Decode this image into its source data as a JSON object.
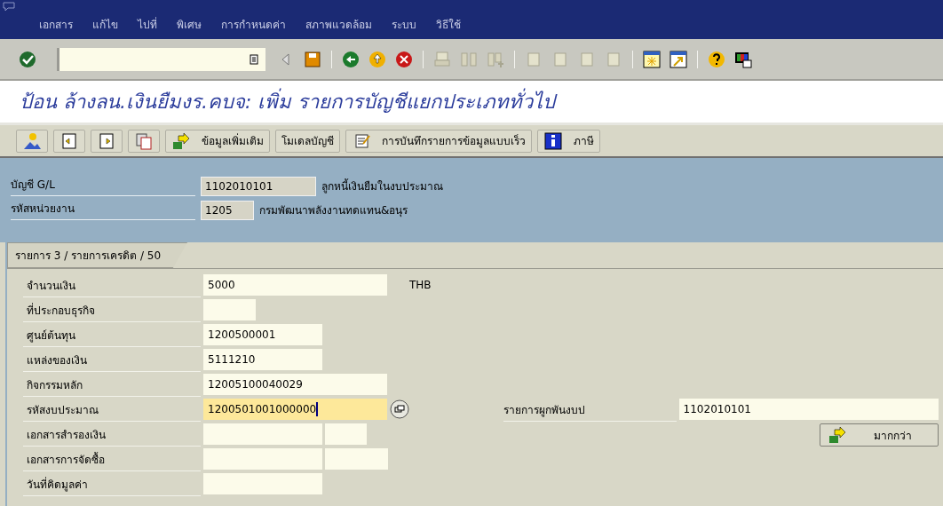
{
  "menu": [
    "เอกสาร",
    "แก้ไข",
    "ไปที่",
    "พิเศษ",
    "การกำหนดค่า",
    "สภาพแวดล้อม",
    "ระบบ",
    "วิธีใช้"
  ],
  "title": "ป้อน ล้างลน.เงินยืมงร.คบจ: เพิ่ม รายการบัญชีแยกประเภททั่วไป",
  "app_toolbar": [
    {
      "kind": "icon"
    },
    {
      "kind": "icon"
    },
    {
      "kind": "icon"
    },
    {
      "kind": "icon"
    },
    {
      "kind": "text",
      "label": "ข้อมูลเพิ่มเติม"
    },
    {
      "kind": "text",
      "label": "โมเดลบัญชี"
    },
    {
      "kind": "text",
      "label": "การบันทึกรายการข้อมูลแบบเร็ว"
    },
    {
      "kind": "text",
      "label": "ภาษี"
    }
  ],
  "header_fields": [
    {
      "label": "บัญชี G/L",
      "value": "1102010101",
      "description": "ลูกหนี้เงินยืมในงบประมาณ"
    },
    {
      "label": "รหัสหน่วยงาน",
      "value": "1205",
      "description": "กรมพัฒนาพลังงานทดแทน&อนุร"
    }
  ],
  "tab": "รายการ 3 / รายการเครดิต / 50",
  "fields": [
    {
      "label": "จำนวนเงิน",
      "value": "5000",
      "unit": "THB",
      "focused": false
    },
    {
      "label": "ที่ประกอบธุรกิจ",
      "focused": false
    },
    {
      "label": "ศูนย์ต้นทุน",
      "value": "1200500001",
      "focused": false
    },
    {
      "label": "แหล่งของเงิน",
      "value": "5111210",
      "focused": false
    },
    {
      "label": "กิจกรรมหลัก",
      "value": "12005100040029",
      "focused": false
    },
    {
      "label": "รหัสงบประมาณ",
      "value": "1200501001000000",
      "focused": true
    },
    {
      "label": "เอกสารสำรองเงิน",
      "focused": false
    },
    {
      "label": "เอกสารการจัดซื้อ",
      "focused": false
    },
    {
      "label": "วันที่คิดมูลค่า",
      "focused": false
    }
  ],
  "side_field": {
    "label": "รายการผูกพันงบป",
    "value": "1102010101"
  },
  "more_button": "มากกว่า"
}
